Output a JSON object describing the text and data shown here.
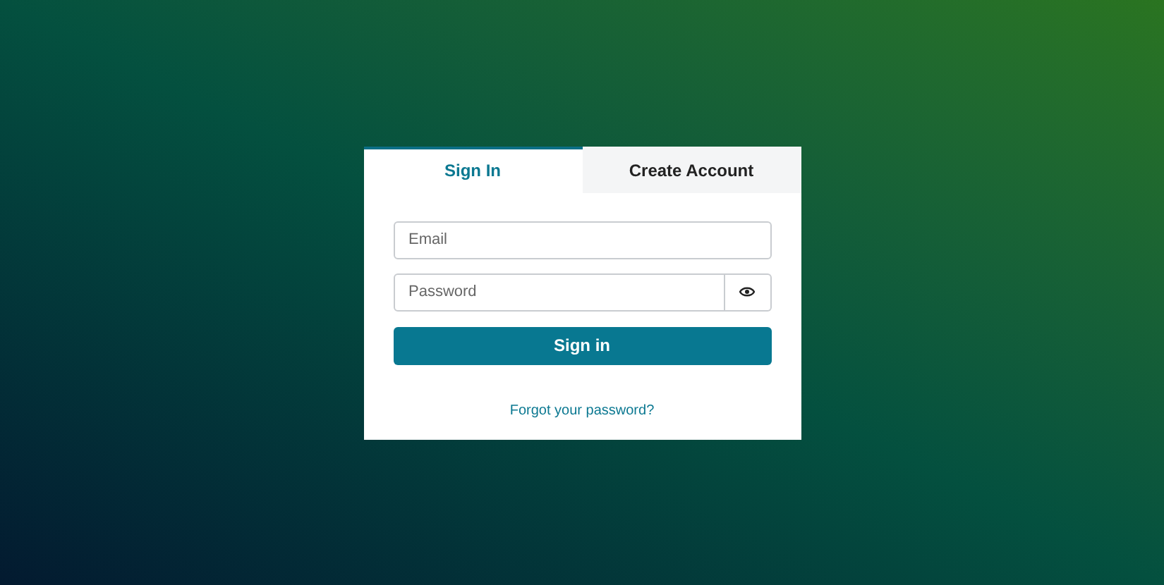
{
  "tabs": [
    {
      "label": "Sign In",
      "selected": true
    },
    {
      "label": "Create Account",
      "selected": false
    }
  ],
  "email": {
    "placeholder": "Email"
  },
  "password": {
    "placeholder": "Password"
  },
  "submit": {
    "label": "Sign in"
  },
  "forgot_link": "Forgot your password?"
}
